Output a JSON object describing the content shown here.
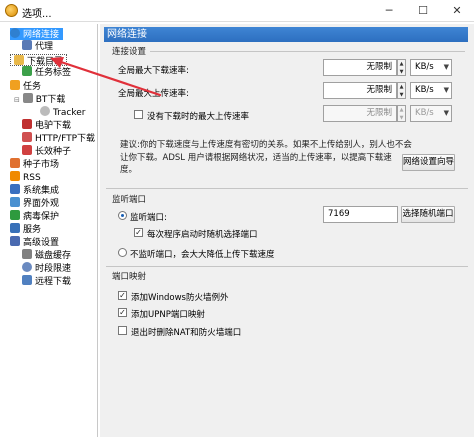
{
  "window": {
    "title": "选项..."
  },
  "sidebar": {
    "items": [
      {
        "label": "网络连接",
        "icon": "globe-icon",
        "color": "#2f80d0"
      },
      {
        "label": "代理",
        "icon": "monitor-icon",
        "color": "#5a7ab5"
      },
      {
        "label": "下载目录",
        "icon": "folder-icon",
        "color": "#e8b84a"
      },
      {
        "label": "任务标签",
        "icon": "tag-icon",
        "color": "#3ca04a"
      },
      {
        "label": "任务",
        "icon": "task-icon",
        "color": "#f0a020"
      },
      {
        "label": "BT下载",
        "icon": "bt-icon",
        "color": "#888888"
      },
      {
        "label": "Tracker",
        "icon": "tracker-icon",
        "color": "#999999"
      },
      {
        "label": "电驴下载",
        "icon": "emule-icon",
        "color": "#c03030"
      },
      {
        "label": "HTTP/FTP下载",
        "icon": "http-icon",
        "color": "#d05050"
      },
      {
        "label": "长效种子",
        "icon": "seed-icon",
        "color": "#d04040"
      },
      {
        "label": "种子市场",
        "icon": "market-icon",
        "color": "#e07030"
      },
      {
        "label": "RSS",
        "icon": "rss-icon",
        "color": "#f08a00"
      },
      {
        "label": "系统集成",
        "icon": "integration-icon",
        "color": "#3a70c0"
      },
      {
        "label": "界面外观",
        "icon": "appearance-icon",
        "color": "#4a90d0"
      },
      {
        "label": "病毒保护",
        "icon": "shield-icon",
        "color": "#2e9a3e"
      },
      {
        "label": "服务",
        "icon": "service-icon",
        "color": "#3870b8"
      },
      {
        "label": "高级设置",
        "icon": "advanced-icon",
        "color": "#4a6ab0"
      },
      {
        "label": "磁盘缓存",
        "icon": "disk-icon",
        "color": "#808080"
      },
      {
        "label": "时段限速",
        "icon": "clock-icon",
        "color": "#6a8ac0"
      },
      {
        "label": "远程下载",
        "icon": "remote-icon",
        "color": "#5080c0"
      }
    ]
  },
  "header": {
    "title": "网络连接"
  },
  "connection": {
    "section_title": "连接设置",
    "max_download_label": "全局最大下载速率:",
    "max_download_value": "无限制",
    "max_download_unit": "KB/s",
    "max_upload_label": "全局最大上传速率:",
    "max_upload_value": "无限制",
    "max_upload_unit": "KB/s",
    "idle_upload_label": "没有下载时的最大上传速率",
    "idle_upload_value": "无限制",
    "idle_upload_unit": "KB/s",
    "info_text_line1": "建议:你的下载速度与上传速度有密切的关系。如果不上传给别人，别人也不会",
    "info_text_line2": "让你下载。ADSL 用户请根据网络状况，适当的上传速率，以提高下载速度。",
    "wizard_button": "网络设置向导"
  },
  "listen": {
    "section_title": "监听端口",
    "port_radio_label": "监听端口:",
    "port_value": "7169",
    "random_button": "选择随机端口",
    "random_on_start_label": "每次程序启动时随机选择端口",
    "no_listen_label": "不监听端口，会大大降低上传下载速度"
  },
  "port_mapping": {
    "section_title": "端口映射",
    "firewall_label": "添加Windows防火墙例外",
    "upnp_label": "添加UPNP端口映射",
    "remove_label": "退出时删除NAT和防火墙端口"
  },
  "colors": {
    "accent": "#2f6fc0",
    "selected": "#3399ff",
    "annotation_arrow": "#e0303a"
  }
}
